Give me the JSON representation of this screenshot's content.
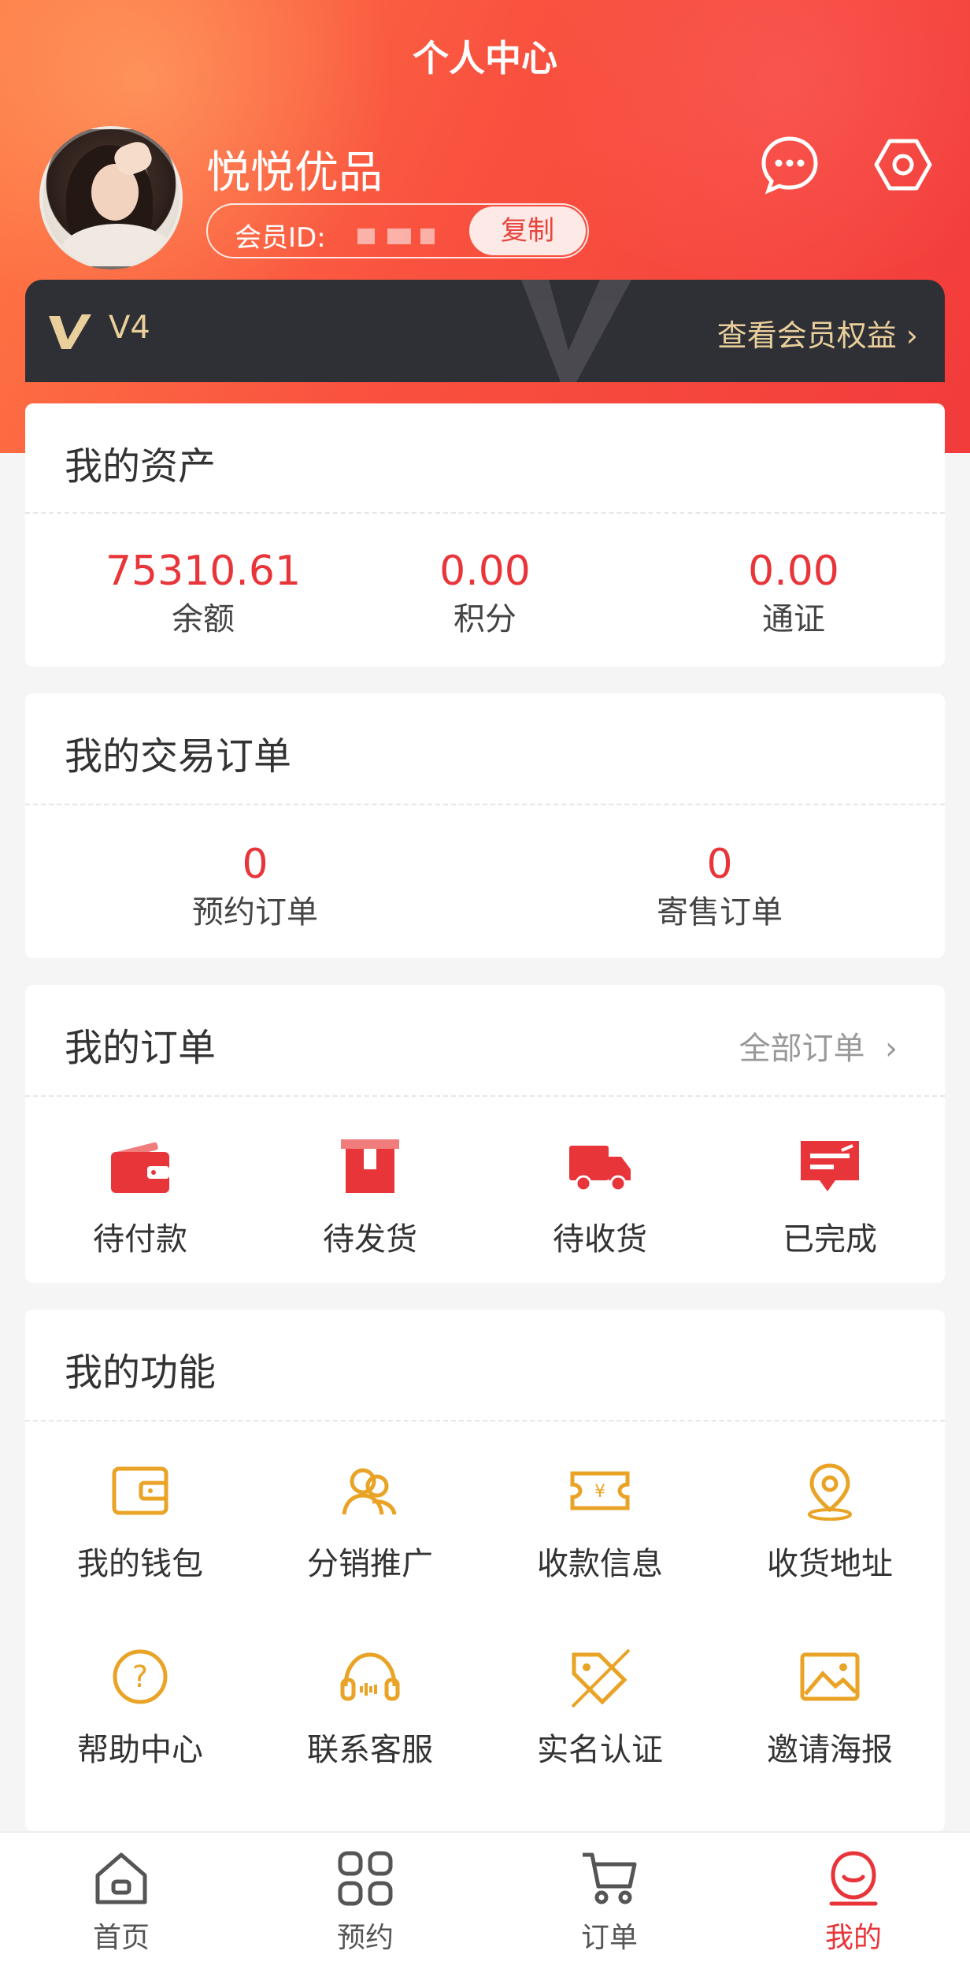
{
  "header": {
    "title": "个人中心",
    "username": "悦悦优品",
    "member_id_label": "会员ID:",
    "copy_label": "复制",
    "vip_level": "V4",
    "vip_benefits_link": "查看会员权益"
  },
  "assets": {
    "title": "我的资产",
    "items": [
      {
        "value": "75310.61",
        "label": "余额"
      },
      {
        "value": "0.00",
        "label": "积分"
      },
      {
        "value": "0.00",
        "label": "通证"
      }
    ]
  },
  "trade_orders": {
    "title": "我的交易订单",
    "items": [
      {
        "value": "0",
        "label": "预约订单"
      },
      {
        "value": "0",
        "label": "寄售订单"
      }
    ]
  },
  "orders": {
    "title": "我的订单",
    "all_link": "全部订单",
    "items": [
      {
        "label": "待付款",
        "icon": "wallet-icon"
      },
      {
        "label": "待发货",
        "icon": "box-icon"
      },
      {
        "label": "待收货",
        "icon": "truck-icon"
      },
      {
        "label": "已完成",
        "icon": "message-check-icon"
      }
    ]
  },
  "functions": {
    "title": "我的功能",
    "items": [
      {
        "label": "我的钱包",
        "icon": "wallet-icon"
      },
      {
        "label": "分销推广",
        "icon": "users-icon"
      },
      {
        "label": "收款信息",
        "icon": "ticket-yen-icon"
      },
      {
        "label": "收货地址",
        "icon": "location-icon"
      },
      {
        "label": "帮助中心",
        "icon": "help-icon"
      },
      {
        "label": "联系客服",
        "icon": "headset-icon"
      },
      {
        "label": "实名认证",
        "icon": "tag-icon"
      },
      {
        "label": "邀请海报",
        "icon": "image-icon"
      }
    ]
  },
  "tabbar": {
    "items": [
      {
        "label": "首页",
        "icon": "home-icon"
      },
      {
        "label": "预约",
        "icon": "grid-icon"
      },
      {
        "label": "订单",
        "icon": "cart-icon"
      },
      {
        "label": "我的",
        "icon": "profile-icon",
        "active": true
      }
    ]
  },
  "colors": {
    "accent": "#e8353a",
    "gold": "#e9a326",
    "vip_gold": "#e9cf9a"
  }
}
